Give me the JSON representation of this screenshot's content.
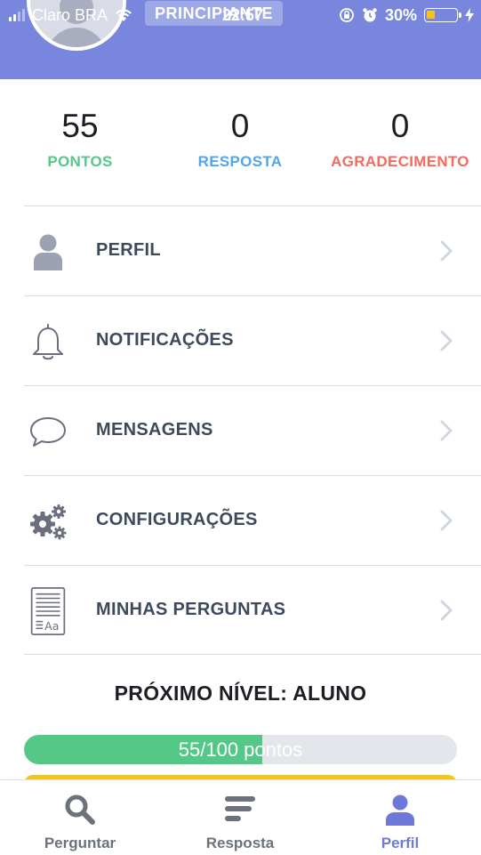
{
  "status_bar": {
    "carrier": "Claro BRA",
    "time": "22:57",
    "battery_percent": "30%",
    "battery_level": 0.3,
    "battery_color": "#f5c518",
    "icons": [
      "signal-icon",
      "wifi-icon",
      "orientation-lock-icon",
      "alarm-icon",
      "battery-icon",
      "charging-icon"
    ]
  },
  "header": {
    "level_badge": "PRINCIPIANTE",
    "background_color": "#7887dd"
  },
  "stats": [
    {
      "value": "55",
      "label": "PONTOS",
      "color": "#54c987"
    },
    {
      "value": "0",
      "label": "RESPOSTA",
      "color": "#4fa8e8"
    },
    {
      "value": "0",
      "label": "AGRADECIMENTO",
      "color": "#f26b5e"
    }
  ],
  "menu": [
    {
      "label": "PERFIL",
      "icon": "user-icon"
    },
    {
      "label": "NOTIFICAÇÕES",
      "icon": "bell-icon"
    },
    {
      "label": "MENSAGENS",
      "icon": "chat-bubble-icon"
    },
    {
      "label": "CONFIGURAÇÕES",
      "icon": "gears-icon"
    },
    {
      "label": "MINHAS PERGUNTAS",
      "icon": "document-icon"
    }
  ],
  "next_level": {
    "title": "PRÓXIMO NÍVEL: ALUNO",
    "progress_text": "55/100 pontos",
    "progress_fraction": 0.55,
    "fill_color": "#54c987"
  },
  "tabs": [
    {
      "label": "Perguntar",
      "icon": "search-icon",
      "active": false
    },
    {
      "label": "Resposta",
      "icon": "answer-lines-icon",
      "active": false
    },
    {
      "label": "Perfil",
      "icon": "user-icon",
      "active": true,
      "color": "#6d78d9"
    }
  ]
}
